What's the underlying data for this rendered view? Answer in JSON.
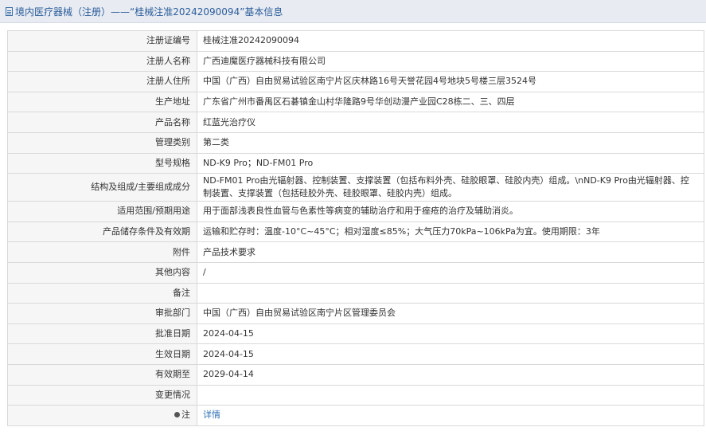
{
  "header": {
    "title": "境内医疗器械（注册）——“桂械注准20242090094”基本信息"
  },
  "rows": [
    {
      "label": "注册证编号",
      "value": "桂械注准20242090094"
    },
    {
      "label": "注册人名称",
      "value": "广西迪魔医疗器械科技有限公司"
    },
    {
      "label": "注册人住所",
      "value": "中国（广西）自由贸易试验区南宁片区庆林路16号天誉花园4号地块5号楼三层3524号"
    },
    {
      "label": "生产地址",
      "value": "广东省广州市番禺区石碁镇金山村华隆路9号华创动漫产业园C28栋二、三、四层"
    },
    {
      "label": "产品名称",
      "value": "红蓝光治疗仪"
    },
    {
      "label": "管理类别",
      "value": "第二类"
    },
    {
      "label": "型号规格",
      "value": "ND-K9 Pro；ND-FM01 Pro"
    },
    {
      "label": "结构及组成/主要组成成分",
      "value": "ND-FM01 Pro由光辐射器、控制装置、支撑装置（包括布料外壳、硅胶眼罩、硅胶内壳）组成。\\nND-K9 Pro由光辐射器、控制装置、支撑装置（包括硅胶外壳、硅胶眼罩、硅胶内壳）组成。"
    },
    {
      "label": "适用范围/预期用途",
      "value": "用于面部浅表良性血管与色素性等病变的辅助治疗和用于痤疮的治疗及辅助消炎。"
    },
    {
      "label": "产品储存条件及有效期",
      "value": "运输和贮存时：温度-10°C~45°C；相对湿度≤85%；大气压力70kPa~106kPa为宜。使用期限：3年"
    },
    {
      "label": "附件",
      "value": "产品技术要求"
    },
    {
      "label": "其他内容",
      "value": "/"
    },
    {
      "label": "备注",
      "value": ""
    },
    {
      "label": "审批部门",
      "value": "中国（广西）自由贸易试验区南宁片区管理委员会"
    },
    {
      "label": "批准日期",
      "value": "2024-04-15"
    },
    {
      "label": "生效日期",
      "value": "2024-04-15"
    },
    {
      "label": "有效期至",
      "value": "2029-04-14"
    },
    {
      "label": "变更情况",
      "value": ""
    }
  ],
  "note": {
    "label": "注",
    "link_text": "详情"
  },
  "colors": {
    "header_bg": "#e8ecf2",
    "title": "#2b5c9a",
    "label_bg": "#f6f6f6",
    "border": "#d9d9d9",
    "link": "#2f6fb5"
  }
}
